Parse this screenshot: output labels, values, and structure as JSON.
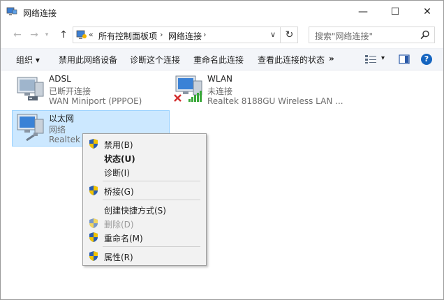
{
  "window": {
    "title": "网络连接",
    "minimize": "—",
    "maximize": "☐",
    "close": "✕"
  },
  "nav": {
    "back": "←",
    "forward": "→",
    "recent": "▾",
    "up": "↑",
    "breadcrumb_chevron": "«",
    "crumbs": [
      "所有控制面板项",
      "网络连接"
    ],
    "crumb_sep": "›",
    "address_dropdown": "∨",
    "refresh": "↻",
    "search_placeholder": "搜索\"网络连接\""
  },
  "commands": {
    "organize": "组织 ▾",
    "disable": "禁用此网络设备",
    "diagnose": "诊断这个连接",
    "rename": "重命名此连接",
    "status": "查看此连接的状态",
    "more": "»",
    "view_dropdown": "▾",
    "help": "?"
  },
  "connections": [
    {
      "name": "ADSL",
      "status": "已断开连接",
      "device": "WAN Miniport (PPPOE)"
    },
    {
      "name": "WLAN",
      "status": "未连接",
      "device": "Realtek 8188GU Wireless LAN ..."
    },
    {
      "name": "以太网",
      "status": "网络",
      "device": "Realtek P"
    }
  ],
  "context_menu": [
    {
      "label": "禁用(B)",
      "shield": true,
      "bold": false,
      "disabled": false
    },
    {
      "label": "状态(U)",
      "shield": false,
      "bold": true,
      "disabled": false
    },
    {
      "label": "诊断(I)",
      "shield": false,
      "bold": false,
      "disabled": false
    },
    {
      "label": "桥接(G)",
      "shield": true,
      "bold": false,
      "disabled": false
    },
    {
      "label": "创建快捷方式(S)",
      "shield": false,
      "bold": false,
      "disabled": false
    },
    {
      "label": "删除(D)",
      "shield": true,
      "bold": false,
      "disabled": true
    },
    {
      "label": "重命名(M)",
      "shield": true,
      "bold": false,
      "disabled": false
    },
    {
      "label": "属性(R)",
      "shield": true,
      "bold": false,
      "disabled": false
    }
  ],
  "colors": {
    "selection": "#cce8ff",
    "selection_border": "#99d1ff",
    "help_blue": "#1565c0",
    "error_red": "#d32f2f",
    "signal_green": "#3aa83a"
  }
}
